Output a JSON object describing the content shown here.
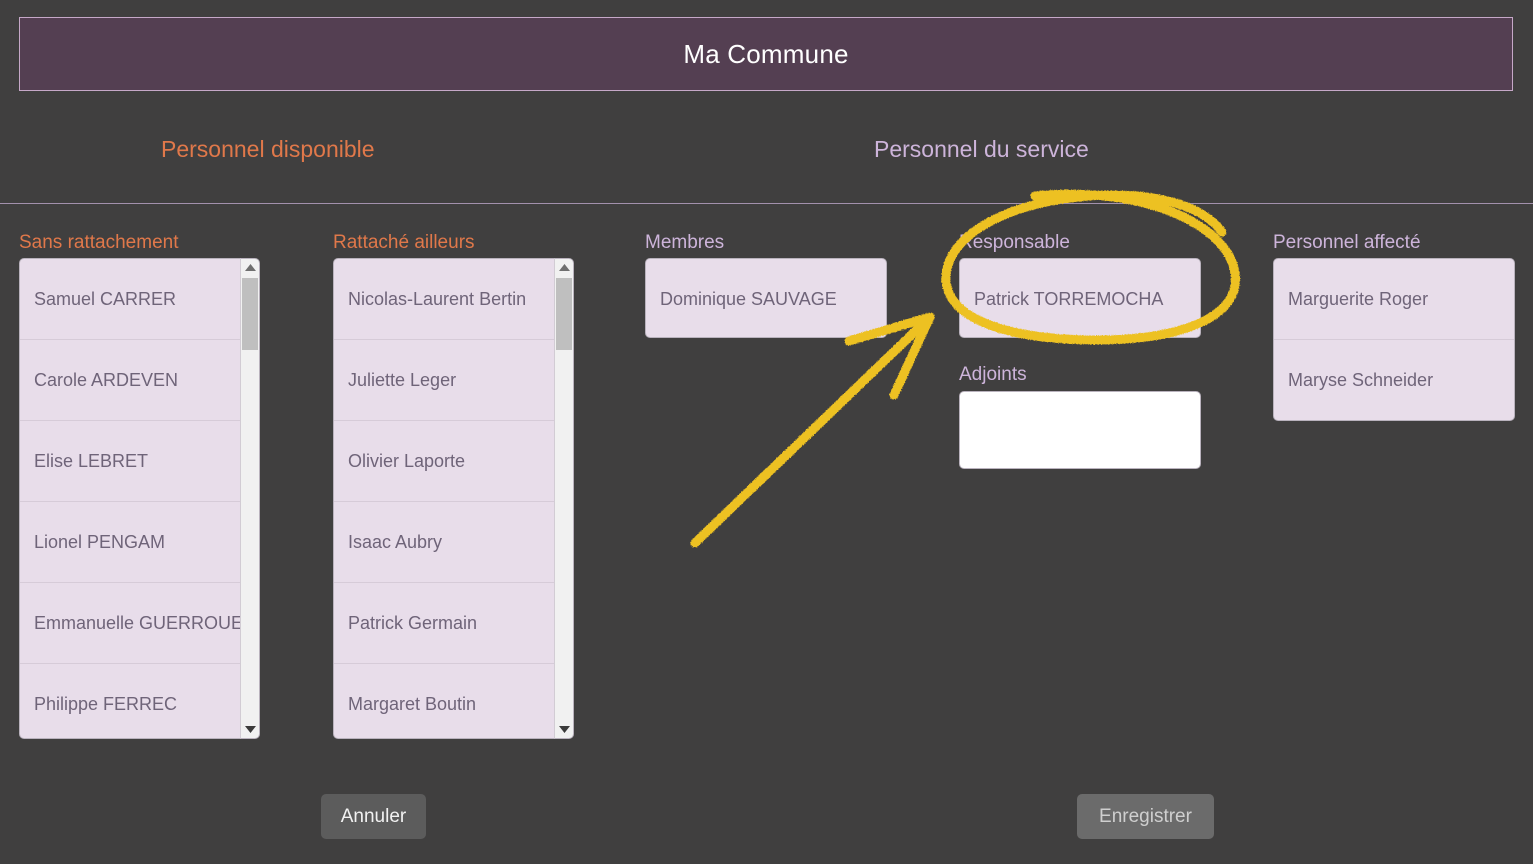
{
  "window": {
    "title": "Ma Commune"
  },
  "sections": {
    "available_label": "Personnel disponible",
    "service_label": "Personnel du service"
  },
  "columns": {
    "sans_rattachement": {
      "label": "Sans rattachement",
      "items": [
        "Samuel CARRER",
        "Carole ARDEVEN",
        "Elise LEBRET",
        "Lionel PENGAM",
        "Emmanuelle GUERROUE",
        "Philippe FERREC"
      ]
    },
    "rattache_ailleurs": {
      "label": "Rattaché ailleurs",
      "items": [
        "Nicolas-Laurent Bertin",
        "Juliette Leger",
        "Olivier Laporte",
        "Isaac Aubry",
        "Patrick Germain",
        "Margaret Boutin"
      ]
    },
    "membres": {
      "label": "Membres",
      "items": [
        "Dominique SAUVAGE"
      ]
    },
    "responsable": {
      "label": "Responsable",
      "items": [
        "Patrick TORREMOCHA"
      ]
    },
    "adjoints": {
      "label": "Adjoints",
      "items": []
    },
    "personnel_affecte": {
      "label": "Personnel affecté",
      "items": [
        "Marguerite Roger",
        "Maryse Schneider"
      ]
    }
  },
  "footer": {
    "cancel_label": "Annuler",
    "save_label": "Enregistrer"
  },
  "annotation": {
    "color": "#edc124",
    "shapes": [
      "ellipse-highlight-responsable",
      "arrow-pointing-to-responsable"
    ]
  },
  "colors": {
    "background": "#403f3f",
    "titlebar": "#543f52",
    "titlebar_border": "#c6a8c8",
    "accent_orange": "#e0784a",
    "accent_lavender": "#cdb4da",
    "list_bg": "#e8ddea",
    "list_text": "#6f6479",
    "annotation_yellow": "#edc124"
  }
}
